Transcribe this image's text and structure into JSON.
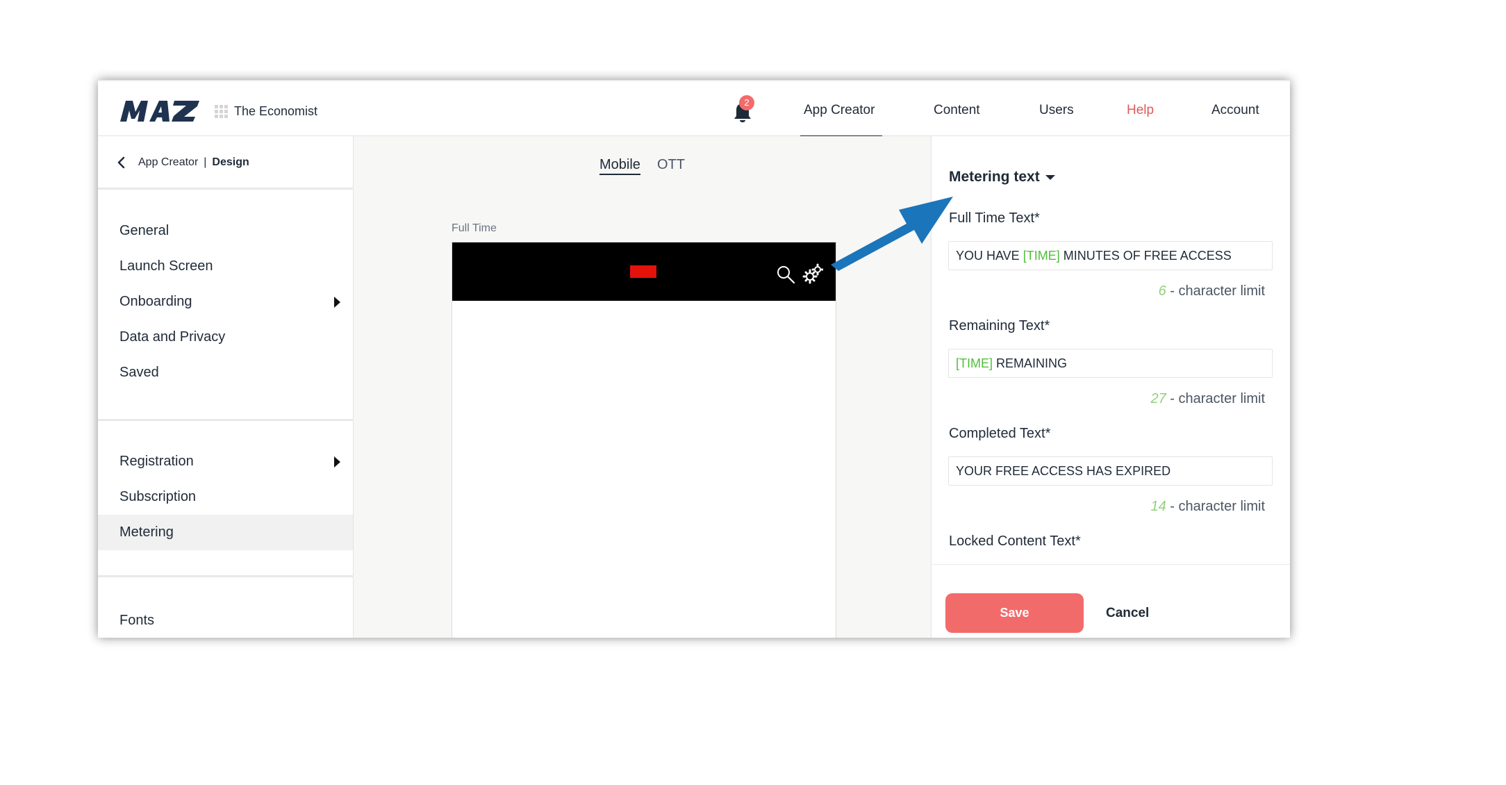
{
  "header": {
    "workspace": "The Economist",
    "notification_count": "2",
    "nav": {
      "app_creator": "App Creator",
      "content": "Content",
      "users": "Users",
      "help": "Help",
      "account": "Account"
    },
    "active_nav": "App Creator"
  },
  "breadcrumb": {
    "parent": "App Creator",
    "separator": "|",
    "current": "Design"
  },
  "sidebar": {
    "group1": [
      "General",
      "Launch Screen",
      "Onboarding",
      "Data and Privacy",
      "Saved"
    ],
    "group2": [
      "Registration",
      "Subscription",
      "Metering"
    ],
    "group3": [
      "Fonts"
    ],
    "active_item": "Metering"
  },
  "preview": {
    "tabs": {
      "mobile": "Mobile",
      "ott": "OTT"
    },
    "active_tab": "Mobile",
    "label": "Full Time",
    "logo_text": "The Economist"
  },
  "panel": {
    "title": "Metering text",
    "fields": {
      "full_time": {
        "label": "Full Time Text*",
        "value_before": "YOU HAVE ",
        "token": "[TIME]",
        "value_after": " MINUTES OF FREE ACCESS",
        "count": "6",
        "limit_text": " - character limit"
      },
      "remaining": {
        "label": "Remaining Text*",
        "token": "[TIME]",
        "value_after": " REMAINING",
        "count": "27",
        "limit_text": " - character limit"
      },
      "completed": {
        "label": "Completed Text*",
        "value": "YOUR FREE ACCESS HAS EXPIRED",
        "count": "14",
        "limit_text": " - character limit"
      },
      "locked": {
        "label": "Locked Content Text*"
      }
    },
    "save_label": "Save",
    "cancel_label": "Cancel"
  },
  "colors": {
    "brand_dark": "#1f2a37",
    "accent_red": "#f26b6b",
    "help_red": "#e05a5a",
    "token_green": "#4fbf3a",
    "annotation_blue": "#1b75bb"
  },
  "icons": [
    "maz-logo",
    "grid-icon",
    "bell-icon",
    "back-icon",
    "chevron-right-icon",
    "search-icon",
    "gear-icon",
    "caret-down-icon",
    "annotation-arrow"
  ]
}
